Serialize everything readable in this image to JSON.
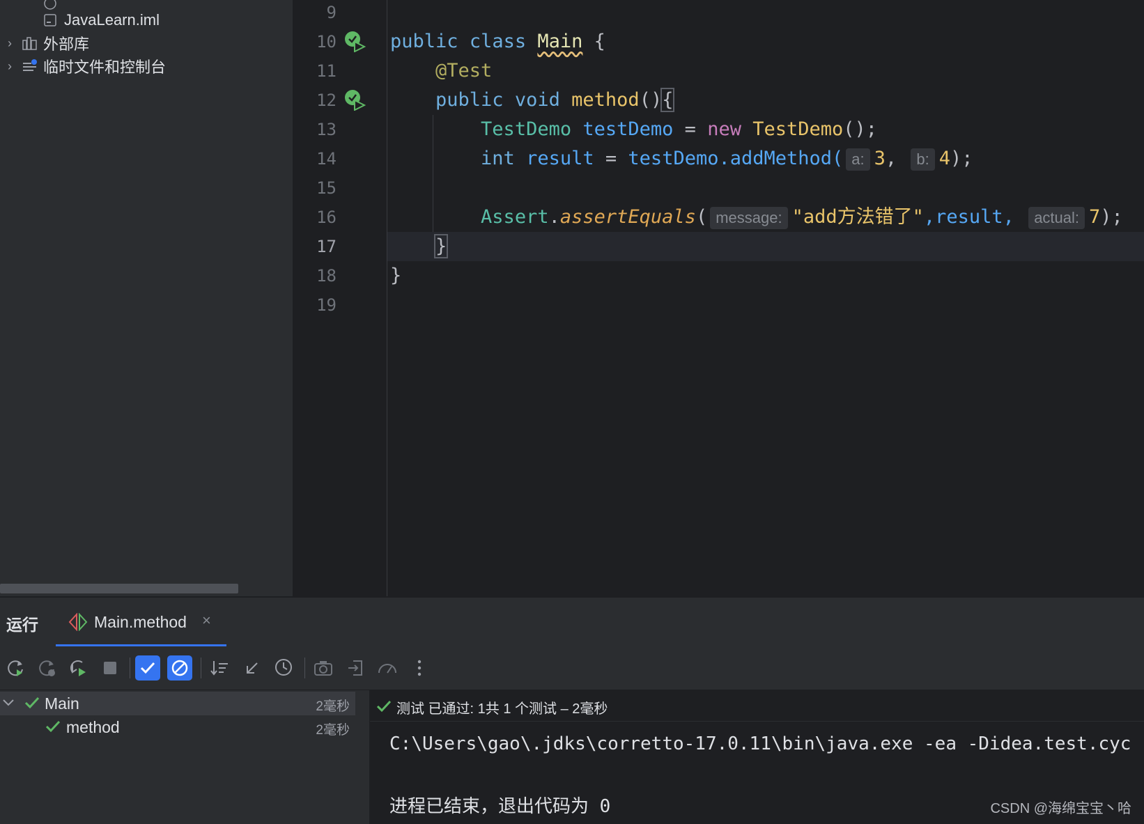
{
  "project_tree": {
    "items": [
      {
        "label": "JavaLearn.iml",
        "icon": "module-file-icon"
      },
      {
        "label": "外部库",
        "icon": "library-icon"
      },
      {
        "label": "临时文件和控制台",
        "icon": "scratches-icon"
      }
    ]
  },
  "editor": {
    "line_numbers": [
      "9",
      "10",
      "11",
      "12",
      "13",
      "14",
      "15",
      "16",
      "17",
      "18",
      "19"
    ],
    "current_line": "17",
    "code": {
      "l10": {
        "kw1": "public",
        "kw2": "class",
        "cls": "Main",
        "rest": " {"
      },
      "l11": {
        "annotation": "@Test"
      },
      "l12": {
        "kw1": "public",
        "kw2": "void",
        "fn": "method",
        "paren": "()",
        "brace": "{"
      },
      "l13": {
        "type": "TestDemo",
        "var": "testDemo",
        "eq": " = ",
        "new": "new",
        "ctor": "TestDemo",
        "tail": "();"
      },
      "l14": {
        "type": "int",
        "var": "result",
        "eq": " = ",
        "call": "testDemo.addMethod(",
        "hint_a": "a:",
        "arg_a": "3",
        "comma": ", ",
        "hint_b": "b:",
        "arg_b": "4",
        "tail": ");"
      },
      "l16": {
        "cls": "Assert",
        "dot": ".",
        "fn": "assertEquals",
        "open": "(",
        "hint_msg": "message:",
        "str": "\"add方法错了\"",
        "mid": ",result, ",
        "hint_act": "actual:",
        "arg": "7",
        "tail": ");"
      },
      "l17": {
        "brace": "}"
      },
      "l18": {
        "brace": "}"
      }
    }
  },
  "run_window": {
    "title": "运行",
    "tab_label": "Main.method",
    "tab_close": "×",
    "toolbar": {
      "rerun": "rerun-icon",
      "rerun_failed": "rerun-failed-icon",
      "toggle_auto_test": "auto-test-icon",
      "stop": "stop-icon",
      "show_passed": "show-passed-icon",
      "show_ignored": "show-ignored-icon",
      "sort": "sort-icon",
      "collapse": "collapse-icon",
      "duration": "clock-icon",
      "screenshot": "camera-icon",
      "import": "import-icon",
      "coverage": "coverage-icon",
      "more": "more-icon"
    },
    "tree": [
      {
        "label": "Main",
        "duration": "2毫秒"
      },
      {
        "label": "method",
        "duration": "2毫秒"
      }
    ],
    "status": "测试 已通过: 1共 1 个测试 – 2毫秒",
    "console_lines": [
      "C:\\Users\\gao\\.jdks\\corretto-17.0.11\\bin\\java.exe -ea -Didea.test.cyc",
      "",
      "进程已结束，退出代码为 0"
    ],
    "watermark": "CSDN @海绵宝宝丶哈"
  },
  "colors": {
    "accent": "#3574f0",
    "pass_green": "#5fb865",
    "editor_bg": "#1e1f22",
    "panel_bg": "#2b2d30"
  }
}
